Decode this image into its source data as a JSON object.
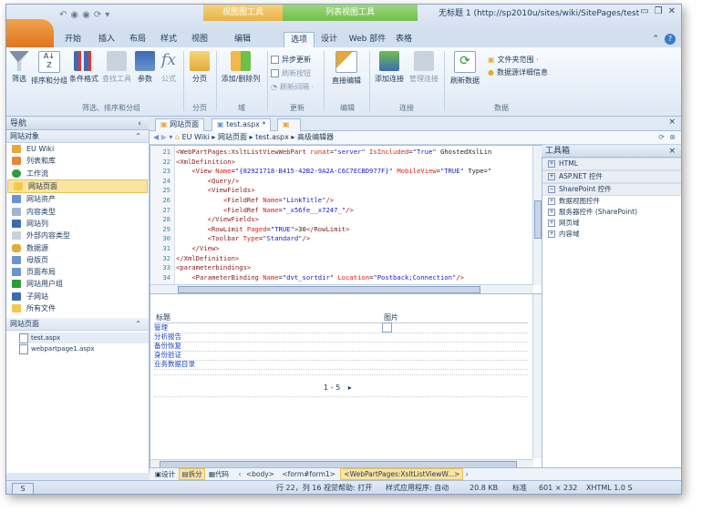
{
  "window": {
    "title": "无标题 1 (http://sp2010u/sites/wiki/SitePages/test....",
    "contextual_tab_1": "视图图工具",
    "contextual_tab_2": "列表视图工具"
  },
  "tabs": [
    "开始",
    "插入",
    "布局",
    "样式",
    "视图",
    "编辑",
    "选项",
    "设计",
    "Web 部件",
    "表格"
  ],
  "ribbon": {
    "buttons": [
      "筛选",
      "排序和分组",
      "条件格式",
      "查找工具",
      "参数",
      "公式",
      "分页",
      "添加/删除列",
      "直接编辑",
      "添加连接",
      "管理连接",
      "刷新数据"
    ],
    "small_items": [
      "异步更新",
      "刷新按钮",
      "刷新间隔 ·",
      "文件夹范围 ·",
      "数据源详细信息"
    ],
    "groups": [
      "筛选、排序和分组",
      "分页",
      "域",
      "更新",
      "编辑",
      "连接",
      "数据"
    ]
  },
  "nav": {
    "header": "导航",
    "collapse": "‹",
    "site_objects_header": "网站对象",
    "items": [
      "EU Wiki",
      "列表和库",
      "工作流",
      "网站页面",
      "网站资产",
      "内容类型",
      "网站列",
      "外部内容类型",
      "数据源",
      "母版页",
      "页面布局",
      "网站用户组",
      "子网站",
      "所有文件"
    ],
    "selected_index": 3,
    "pages_header": "网站页面",
    "files": [
      "test.aspx",
      "webpartpage1.aspx"
    ]
  },
  "doc_tabs": [
    "网站页面",
    "test.aspx *"
  ],
  "breadcrumb": [
    "EU Wiki",
    "网站页面",
    "test.aspx",
    "高级编辑器"
  ],
  "code": {
    "lines": [
      {
        "n": "21",
        "t": "<WebPartPages:XsltListViewWebPart runat=\"server\" IsIncluded=\"True\" GhostedXslLin"
      },
      {
        "n": "22",
        "t": "<XmlDefinition>"
      },
      {
        "n": "23",
        "t": "    <View Name=\"{82921718-B415-42B2-9A2A-C6C7ECBD977F}\" MobileView=\"TRUE\" Type=\""
      },
      {
        "n": "24",
        "t": "        <Query/>"
      },
      {
        "n": "25",
        "t": "        <ViewFields>"
      },
      {
        "n": "26",
        "t": "            <FieldRef Name=\"LinkTitle\"/>"
      },
      {
        "n": "27",
        "t": "            <FieldRef Name=\"_x56fe__x7247_\"/>"
      },
      {
        "n": "28",
        "t": "        </ViewFields>"
      },
      {
        "n": "29",
        "t": "        <RowLimit Paged=\"TRUE\">30</RowLimit>"
      },
      {
        "n": "30",
        "t": "        <Toolbar Type=\"Standard\"/>"
      },
      {
        "n": "31",
        "t": "    </View>"
      },
      {
        "n": "32",
        "t": "</XmlDefinition>"
      },
      {
        "n": "33",
        "t": "<parameterbindings>"
      },
      {
        "n": "34",
        "t": "    <ParameterBinding Name=\"dvt_sortdir\" Location=\"Postback;Connection\"/>"
      }
    ]
  },
  "design": {
    "col_title": "标题",
    "col_image": "图片",
    "rows": [
      "管理",
      "分析报告",
      "备份恢复",
      "身份验证",
      "业务数据目录"
    ],
    "pager": "1 - 5",
    "pager_next": "▸"
  },
  "toolbox": {
    "header": "工具箱",
    "items": [
      {
        "label": "HTML",
        "type": "collapsed-header"
      },
      {
        "label": "ASP.NET 控件",
        "type": "collapsed-header"
      },
      {
        "label": "SharePoint 控件",
        "type": "expanded-header"
      },
      {
        "label": "数据视图控件",
        "type": "child"
      },
      {
        "label": "服务器控件 (SharePoint)",
        "type": "child"
      },
      {
        "label": "网页域",
        "type": "child"
      },
      {
        "label": "内容域",
        "type": "child"
      }
    ]
  },
  "viewbar": {
    "views": [
      "设计",
      "拆分",
      "代码"
    ],
    "crumbs": [
      "<body>",
      "<form#form1>",
      "<WebPartPages:XsltListViewW...>"
    ]
  },
  "status": {
    "position": "行 22，列 16",
    "visual_aid": "视觉帮助: 打开",
    "style_app": "样式应用程序: 自动",
    "size": "20.8 KB",
    "mode": "标准",
    "dims": "601 × 232",
    "doctype": "XHTML 1.0 S"
  },
  "colors": {
    "accent": "#f1a14c",
    "selected": "#fbe3a0",
    "ribbon": "#dde8f5",
    "link": "#1f47c4"
  }
}
